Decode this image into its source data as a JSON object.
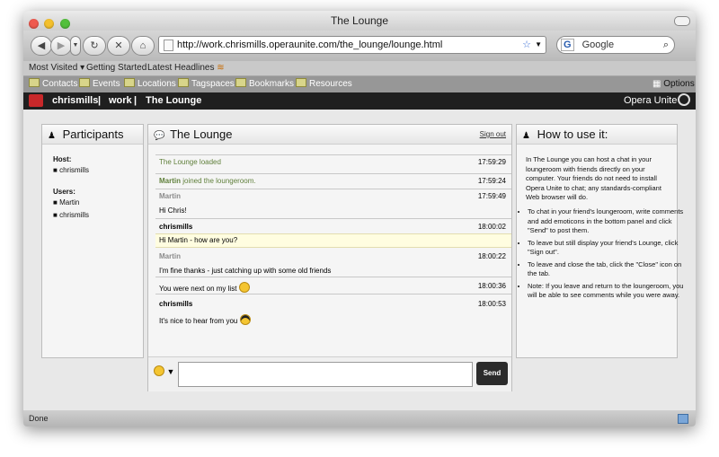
{
  "window": {
    "title": "The Lounge"
  },
  "toolbar": {
    "url": "http://work.chrismills.operaunite.com/the_lounge/lounge.html",
    "search_placeholder": "Google"
  },
  "bookmarks1": [
    "Most Visited",
    "Getting Started",
    "Latest Headlines"
  ],
  "bookmarks2": [
    "Contacts",
    "Events",
    "Locations",
    "Tagspaces",
    "Bookmarks",
    "Resources"
  ],
  "bookmarks2_options": "Options",
  "opera": {
    "user": "chrismills",
    "work": "work",
    "lounge": "The Lounge",
    "sep": "|",
    "brand": "Opera Unite"
  },
  "participants": {
    "title": "Participants",
    "host_label": "Host:",
    "host": "chrismills",
    "users_label": "Users:",
    "users": [
      "Martin",
      "chrismills"
    ]
  },
  "lounge": {
    "title": "The Lounge",
    "signout": "Sign out",
    "messages": [
      {
        "type": "system",
        "text": "The Lounge loaded",
        "time": "17:59:29"
      },
      {
        "type": "join",
        "name": "Martin",
        "text": " joined the loungeroom.",
        "time": "17:59:24"
      },
      {
        "type": "msg",
        "name": "Martin",
        "text": "Hi Chris!",
        "time": "17:59:49"
      },
      {
        "type": "msg",
        "name": "chrismills",
        "text": "Hi Martin - how are you?",
        "time": "18:00:02"
      },
      {
        "type": "msg",
        "name": "Martin",
        "text": "I'm fine thanks - just catching up with some old friends",
        "time": "18:00:22"
      },
      {
        "type": "msg_noname",
        "text": "You were next on my list",
        "time": "18:00:36"
      },
      {
        "type": "msg",
        "name": "chrismills",
        "text": "It's nice to hear from you",
        "time": "18:00:53"
      }
    ],
    "send": "Send"
  },
  "howto": {
    "title": "How to use it:",
    "intro": "In The Lounge you can host a chat in your loungeroom with friends directly on your computer. Your friends do not need to install Opera Unite to chat; any standards-compliant Web browser will do.",
    "items": [
      "To chat in your friend's loungeroom, write comments and add emoticons in the bottom panel and click \"Send\" to post them.",
      "To leave but still display your friend's Lounge, click \"Sign out\".",
      "To leave and close the tab, click the \"Close\" icon on the tab.",
      "Note: If you leave and return to the loungeroom, you will be able to see comments while you were away."
    ]
  },
  "status": {
    "text": "Done"
  },
  "colors": {
    "system_text": "#5f7f3a",
    "highlight_bg": "#fffde0"
  }
}
